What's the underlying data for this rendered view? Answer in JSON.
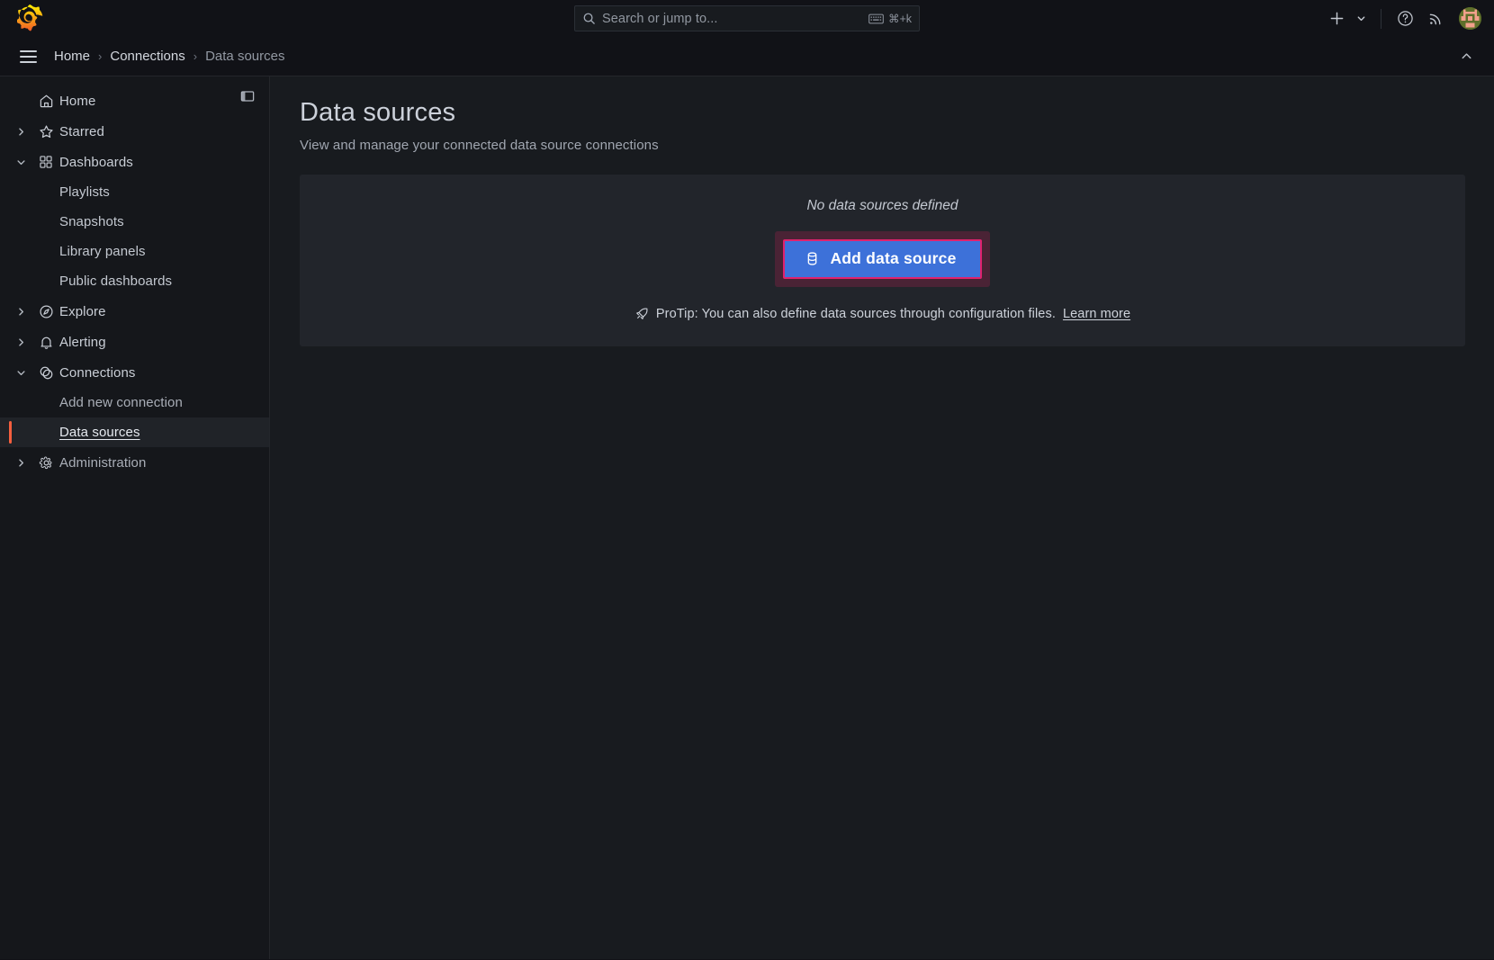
{
  "topbar": {
    "logo_icon": "grafana-logo-icon",
    "search": {
      "icon": "search-icon",
      "placeholder": "Search or jump to...",
      "kbd_icon": "keyboard-icon",
      "shortcut": "⌘+k"
    },
    "actions": {
      "new_icon": "plus-icon",
      "new_caret_icon": "chevron-down-icon",
      "help_icon": "help-circle-icon",
      "news_icon": "rss-icon",
      "avatar": "user-avatar"
    }
  },
  "breadcrumb": {
    "menu_icon": "hamburger-menu-icon",
    "items": [
      {
        "label": "Home",
        "current": false
      },
      {
        "label": "Connections",
        "current": false
      },
      {
        "label": "Data sources",
        "current": true
      }
    ],
    "separator": "›",
    "collapse_icon": "chevron-up-icon"
  },
  "sidebar": {
    "dock_icon": "dock-menu-icon",
    "items": [
      {
        "label": "Home",
        "icon": "home-icon",
        "caret": "none",
        "level": 0,
        "active": false
      },
      {
        "label": "Starred",
        "icon": "star-icon",
        "caret": "right",
        "level": 0,
        "active": false
      },
      {
        "label": "Dashboards",
        "icon": "dashboards-grid-icon",
        "caret": "down",
        "level": 0,
        "active": false
      },
      {
        "label": "Playlists",
        "icon": "none",
        "caret": "none",
        "level": 1,
        "active": false
      },
      {
        "label": "Snapshots",
        "icon": "none",
        "caret": "none",
        "level": 1,
        "active": false
      },
      {
        "label": "Library panels",
        "icon": "none",
        "caret": "none",
        "level": 1,
        "active": false
      },
      {
        "label": "Public dashboards",
        "icon": "none",
        "caret": "none",
        "level": 1,
        "active": false
      },
      {
        "label": "Explore",
        "icon": "compass-icon",
        "caret": "right",
        "level": 0,
        "active": false
      },
      {
        "label": "Alerting",
        "icon": "bell-icon",
        "caret": "right",
        "level": 0,
        "active": false
      },
      {
        "label": "Connections",
        "icon": "connections-icon",
        "caret": "down",
        "level": 0,
        "active": false
      },
      {
        "label": "Add new connection",
        "icon": "none",
        "caret": "none",
        "level": 1,
        "active": false
      },
      {
        "label": "Data sources",
        "icon": "none",
        "caret": "none",
        "level": 1,
        "active": true
      },
      {
        "label": "Administration",
        "icon": "gear-icon",
        "caret": "right",
        "level": 0,
        "active": false
      }
    ]
  },
  "main": {
    "title": "Data sources",
    "subtitle": "View and manage your connected data source connections",
    "empty": {
      "message": "No data sources defined",
      "button_label": "Add data source",
      "button_icon": "database-icon",
      "highlighted": true
    },
    "protip": {
      "icon": "rocket-icon",
      "text": "ProTip: You can also define data sources through configuration files.",
      "link_label": "Learn more"
    }
  },
  "colors": {
    "page_bg": "#181b1f",
    "chrome_bg": "#111217",
    "sidebar_bg": "#15171b",
    "panel_bg": "#22252b",
    "primary_button": "#3d71d9",
    "highlight_border": "#e0226e",
    "active_indicator": "#f55f3e",
    "brand_orange": "#f5a524"
  }
}
